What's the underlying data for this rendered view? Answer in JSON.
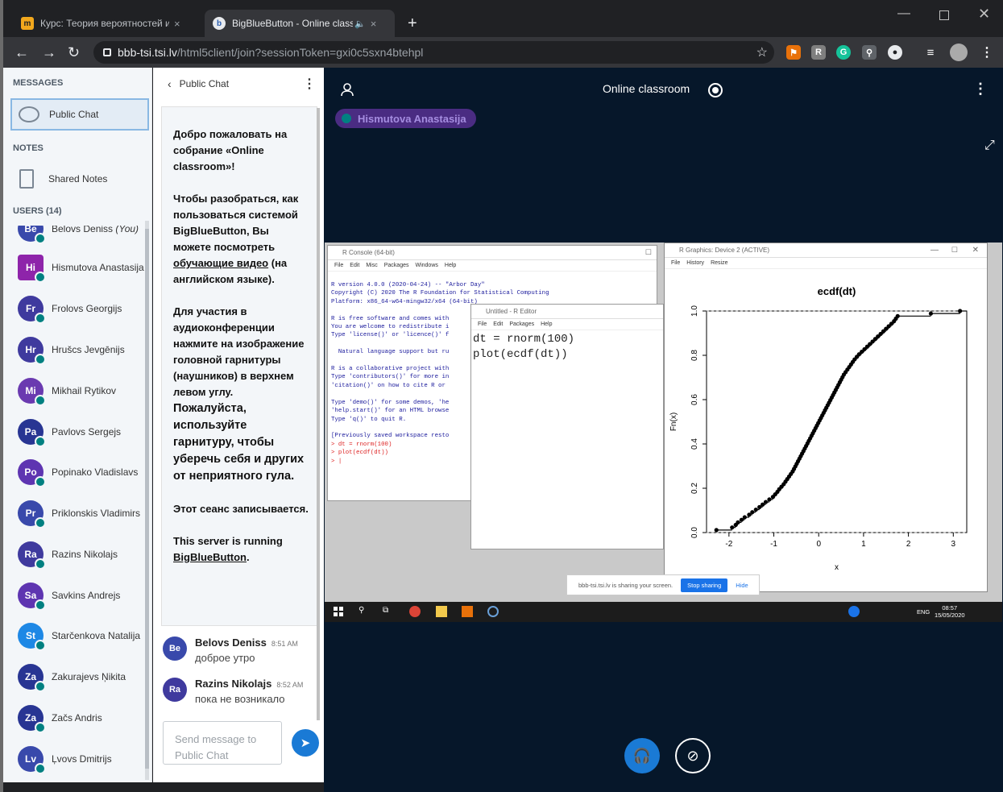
{
  "browser": {
    "tabs": [
      {
        "title": "Курс: Теория вероятностей и математическая статистика",
        "close": "×"
      },
      {
        "title": "BigBlueButton - Online classroom",
        "close": "×"
      }
    ],
    "new_tab": "+",
    "url_host": "bbb-tsi.tsi.lv",
    "url_path": "/html5client/join?sessionToken=gxi0c5sxn4btehpl"
  },
  "sidebar": {
    "messages_label": "MESSAGES",
    "public_chat": "Public Chat",
    "notes_label": "NOTES",
    "shared_notes": "Shared Notes",
    "users_label": "USERS (14)",
    "users": [
      {
        "initials": "Be",
        "name": "Belovs Deniss",
        "you": "(You)",
        "color": "#3949ab"
      },
      {
        "initials": "Hi",
        "name": "Hismutova Anastasija",
        "color": "#8e24aa"
      },
      {
        "initials": "Fr",
        "name": "Frolovs Georgijs",
        "color": "#3f3a9e"
      },
      {
        "initials": "Hr",
        "name": "Hrušcs Jevgēnijs",
        "color": "#3f3a9e"
      },
      {
        "initials": "Mi",
        "name": "Mikhail Rytikov",
        "color": "#6a3ab0"
      },
      {
        "initials": "Pa",
        "name": "Pavlovs Sergejs",
        "color": "#283593"
      },
      {
        "initials": "Po",
        "name": "Popinako Vladislavs",
        "color": "#5e35b1"
      },
      {
        "initials": "Pr",
        "name": "Priklonskis Vladimirs",
        "color": "#3949ab"
      },
      {
        "initials": "Ra",
        "name": "Razins Nikolajs",
        "color": "#3f3a9e"
      },
      {
        "initials": "Sa",
        "name": "Savkins Andrejs",
        "color": "#5e35b1"
      },
      {
        "initials": "St",
        "name": "Starčenkova Natalija",
        "color": "#1e88e5"
      },
      {
        "initials": "Za",
        "name": "Zakurajevs Ņikita",
        "color": "#283593"
      },
      {
        "initials": "Za",
        "name": "Začs Andris",
        "color": "#283593"
      },
      {
        "initials": "Lv",
        "name": "Ļvovs Dmitrijs",
        "color": "#3949ab"
      }
    ]
  },
  "chat": {
    "header": "Public Chat",
    "welcome": {
      "p1": "Добро пожаловать на собрание «Online classroom»!",
      "p2a": "Чтобы разобраться, как пользоваться системой BigBlueButton, Вы можете посмотреть ",
      "p2link": "обучающие видео",
      "p2b": " (на английском языке).",
      "p3": "Для участия в аудиоконференции нажмите на изображение головной гарнитуры (наушников) в верхнем левом углу.",
      "p3big": "Пожалуйста, используйте гарнитуру, чтобы уберечь себя и других от неприятного гула.",
      "p4": "Этот сеанс записывается.",
      "p5a": "This server is running ",
      "p5link": "BigBlueButton",
      "p5b": "."
    },
    "messages": [
      {
        "initials": "Be",
        "name": "Belovs Deniss",
        "time": "8:51 AM",
        "text": "доброе утро",
        "color": "#3949ab"
      },
      {
        "initials": "Ra",
        "name": "Razins Nikolajs",
        "time": "8:52 AM",
        "text": "пока не возникало",
        "color": "#3f3a9e"
      }
    ],
    "input_placeholder": "Send message to Public Chat"
  },
  "main": {
    "title": "Online classroom",
    "talking": "Hismutova Anastasija"
  },
  "screen": {
    "console_title": "R Console (64-bit)",
    "console_menu": [
      "File",
      "Edit",
      "Misc",
      "Packages",
      "Windows",
      "Help"
    ],
    "console_text": "R version 4.0.0 (2020-04-24) -- \"Arbor Day\"\nCopyright (C) 2020 The R Foundation for Statistical Computing\nPlatform: x86_64-w64-mingw32/x64 (64-bit)\n\nR is free software and comes with\nYou are welcome to redistribute i\nType 'license()' or 'licence()' f\n\n  Natural language support but ru\n\nR is a collaborative project with\nType 'contributors()' for more in\n'citation()' on how to cite R or\n\nType 'demo()' for some demos, 'he\n'help.start()' for an HTML browse\nType 'q()' to quit R.\n\n[Previously saved workspace resto",
    "console_cmds": "> dt = rnorm(100)\n> plot(ecdf(dt))\n> |",
    "editor_title": "Untitled - R Editor",
    "editor_menu": [
      "File",
      "Edit",
      "Packages",
      "Help"
    ],
    "editor_code": "dt = rnorm(100)\nplot(ecdf(dt))",
    "graphics_title": "R Graphics: Device 2 (ACTIVE)",
    "graphics_menu": [
      "File",
      "History",
      "Resize"
    ],
    "share_text": "bbb-tsi.tsi.lv is sharing your screen.",
    "stop_sharing": "Stop sharing",
    "hide": "Hide",
    "lang": "ENG",
    "clock_time": "08:57",
    "clock_date": "15/05/2020"
  },
  "chart_data": {
    "type": "scatter",
    "title": "ecdf(dt)",
    "xlabel": "x",
    "ylabel": "Fn(x)",
    "xlim": [
      -2.5,
      3.3
    ],
    "ylim": [
      0,
      1
    ],
    "xticks": [
      -2,
      -1,
      0,
      1,
      2,
      3
    ],
    "yticks": [
      0.0,
      0.2,
      0.4,
      0.6,
      0.8,
      1.0
    ],
    "series": [
      {
        "x": [
          -2.28,
          -1.93,
          -1.85,
          -1.8,
          -1.72,
          -1.65,
          -1.55,
          -1.48,
          -1.4,
          -1.32,
          -1.25,
          -1.18,
          -1.1,
          -1.02,
          -0.97,
          -0.92,
          -0.88,
          -0.83,
          -0.78,
          -0.74,
          -0.7,
          -0.66,
          -0.62,
          -0.58,
          -0.55,
          -0.52,
          -0.49,
          -0.46,
          -0.43,
          -0.4,
          -0.37,
          -0.34,
          -0.31,
          -0.28,
          -0.25,
          -0.22,
          -0.19,
          -0.16,
          -0.13,
          -0.1,
          -0.07,
          -0.04,
          -0.01,
          0.02,
          0.05,
          0.08,
          0.11,
          0.14,
          0.17,
          0.2,
          0.23,
          0.26,
          0.29,
          0.32,
          0.35,
          0.38,
          0.41,
          0.44,
          0.47,
          0.5,
          0.53,
          0.56,
          0.6,
          0.64,
          0.68,
          0.72,
          0.76,
          0.8,
          0.85,
          0.9,
          0.96,
          1.02,
          1.08,
          1.14,
          1.2,
          1.26,
          1.32,
          1.38,
          1.44,
          1.5,
          1.56,
          1.62,
          1.68,
          1.72,
          1.76,
          2.5,
          3.15
        ]
      }
    ]
  }
}
